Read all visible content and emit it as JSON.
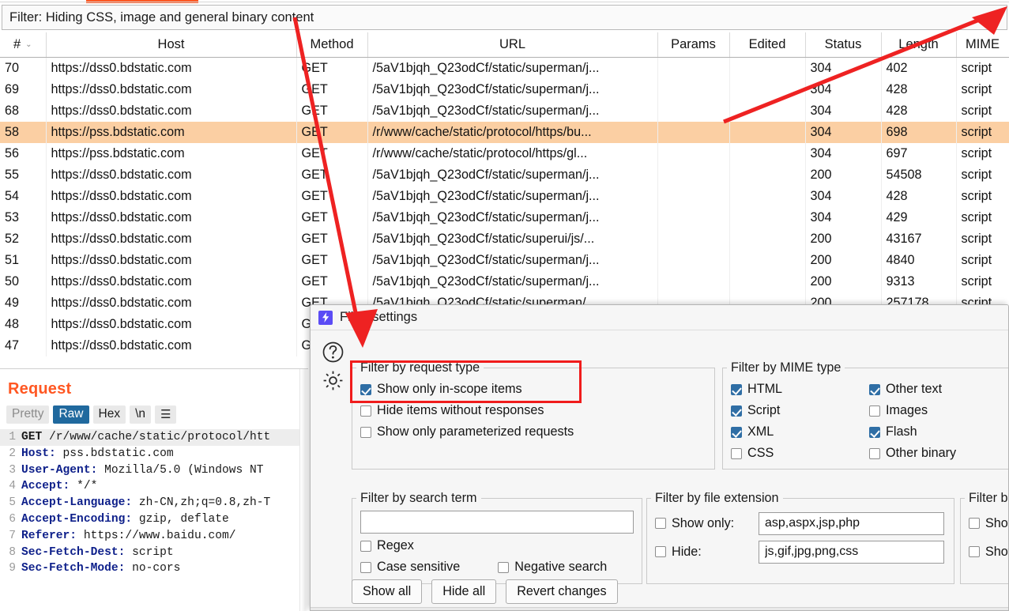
{
  "window": {
    "filter_bar_text": "Filter: Hiding CSS, image and general binary content",
    "accent_color": "#ff5722",
    "selection_color": "#fbcfa3",
    "annotation_color": "#f01c1c"
  },
  "table": {
    "columns": [
      {
        "key": "num",
        "label": "#",
        "sorted": true,
        "sort_caret": "⌄"
      },
      {
        "key": "host",
        "label": "Host"
      },
      {
        "key": "method",
        "label": "Method"
      },
      {
        "key": "url",
        "label": "URL"
      },
      {
        "key": "params",
        "label": "Params"
      },
      {
        "key": "edited",
        "label": "Edited"
      },
      {
        "key": "status",
        "label": "Status"
      },
      {
        "key": "length",
        "label": "Length"
      },
      {
        "key": "mime",
        "label": "MIME"
      }
    ],
    "rows": [
      {
        "num": "70",
        "host": "https://dss0.bdstatic.com",
        "method": "GET",
        "url": "/5aV1bjqh_Q23odCf/static/superman/j...",
        "params": "",
        "edited": "",
        "status": "304",
        "length": "402",
        "mime": "script",
        "selected": false
      },
      {
        "num": "69",
        "host": "https://dss0.bdstatic.com",
        "method": "GET",
        "url": "/5aV1bjqh_Q23odCf/static/superman/j...",
        "params": "",
        "edited": "",
        "status": "304",
        "length": "428",
        "mime": "script",
        "selected": false
      },
      {
        "num": "68",
        "host": "https://dss0.bdstatic.com",
        "method": "GET",
        "url": "/5aV1bjqh_Q23odCf/static/superman/j...",
        "params": "",
        "edited": "",
        "status": "304",
        "length": "428",
        "mime": "script",
        "selected": false
      },
      {
        "num": "58",
        "host": "https://pss.bdstatic.com",
        "method": "GET",
        "url": "/r/www/cache/static/protocol/https/bu...",
        "params": "",
        "edited": "",
        "status": "304",
        "length": "698",
        "mime": "script",
        "selected": true
      },
      {
        "num": "56",
        "host": "https://pss.bdstatic.com",
        "method": "GET",
        "url": "/r/www/cache/static/protocol/https/gl...",
        "params": "",
        "edited": "",
        "status": "304",
        "length": "697",
        "mime": "script",
        "selected": false
      },
      {
        "num": "55",
        "host": "https://dss0.bdstatic.com",
        "method": "GET",
        "url": "/5aV1bjqh_Q23odCf/static/superman/j...",
        "params": "",
        "edited": "",
        "status": "200",
        "length": "54508",
        "mime": "script",
        "selected": false
      },
      {
        "num": "54",
        "host": "https://dss0.bdstatic.com",
        "method": "GET",
        "url": "/5aV1bjqh_Q23odCf/static/superman/j...",
        "params": "",
        "edited": "",
        "status": "304",
        "length": "428",
        "mime": "script",
        "selected": false
      },
      {
        "num": "53",
        "host": "https://dss0.bdstatic.com",
        "method": "GET",
        "url": "/5aV1bjqh_Q23odCf/static/superman/j...",
        "params": "",
        "edited": "",
        "status": "304",
        "length": "429",
        "mime": "script",
        "selected": false
      },
      {
        "num": "52",
        "host": "https://dss0.bdstatic.com",
        "method": "GET",
        "url": "/5aV1bjqh_Q23odCf/static/superui/js/...",
        "params": "",
        "edited": "",
        "status": "200",
        "length": "43167",
        "mime": "script",
        "selected": false
      },
      {
        "num": "51",
        "host": "https://dss0.bdstatic.com",
        "method": "GET",
        "url": "/5aV1bjqh_Q23odCf/static/superman/j...",
        "params": "",
        "edited": "",
        "status": "200",
        "length": "4840",
        "mime": "script",
        "selected": false
      },
      {
        "num": "50",
        "host": "https://dss0.bdstatic.com",
        "method": "GET",
        "url": "/5aV1bjqh_Q23odCf/static/superman/j...",
        "params": "",
        "edited": "",
        "status": "200",
        "length": "9313",
        "mime": "script",
        "selected": false
      },
      {
        "num": "49",
        "host": "https://dss0.bdstatic.com",
        "method": "GET",
        "url": "/5aV1bjqh_Q23odCf/static/superman/...",
        "params": "",
        "edited": "",
        "status": "200",
        "length": "257178",
        "mime": "script",
        "selected": false
      },
      {
        "num": "48",
        "host": "https://dss0.bdstatic.com",
        "method": "G",
        "url": "",
        "params": "",
        "edited": "",
        "status": "",
        "length": "",
        "mime": "",
        "selected": false
      },
      {
        "num": "47",
        "host": "https://dss0.bdstatic.com",
        "method": "G",
        "url": "",
        "params": "",
        "edited": "",
        "status": "",
        "length": "",
        "mime": "",
        "selected": false
      }
    ]
  },
  "request_panel": {
    "title": "Request",
    "tabs": [
      {
        "label": "Pretty",
        "state": "inactive"
      },
      {
        "label": "Raw",
        "state": "active"
      },
      {
        "label": "Hex",
        "state": "dark"
      },
      {
        "label": "\\n",
        "state": "dark"
      }
    ],
    "menu_icon": "hamburger-icon",
    "lines": [
      {
        "n": "1",
        "key": "GET",
        "val": " /r/www/cache/static/protocol/htt",
        "bold_key": true
      },
      {
        "n": "2",
        "key": "Host:",
        "val": " pss.bdstatic.com"
      },
      {
        "n": "3",
        "key": "User-Agent:",
        "val": " Mozilla/5.0 (Windows NT"
      },
      {
        "n": "4",
        "key": "Accept:",
        "val": " */*"
      },
      {
        "n": "5",
        "key": "Accept-Language:",
        "val": " zh-CN,zh;q=0.8,zh-T"
      },
      {
        "n": "6",
        "key": "Accept-Encoding:",
        "val": " gzip, deflate"
      },
      {
        "n": "7",
        "key": "Referer:",
        "val": " https://www.baidu.com/"
      },
      {
        "n": "8",
        "key": "Sec-Fetch-Dest:",
        "val": " script"
      },
      {
        "n": "9",
        "key": "Sec-Fetch-Mode:",
        "val": " no-cors"
      }
    ]
  },
  "dialog": {
    "title": "Filter settings",
    "app_icon": "burp-logo-icon",
    "help_icon": "question-circle-icon",
    "settings_icon": "gear-icon",
    "request_type": {
      "legend": "Filter by request type",
      "highlighted": true,
      "items": [
        {
          "label": "Show only in-scope items",
          "checked": true
        },
        {
          "label": "Hide items without responses",
          "checked": false
        },
        {
          "label": "Show only parameterized requests",
          "checked": false
        }
      ]
    },
    "mime_type": {
      "legend": "Filter by MIME type",
      "left": [
        {
          "label": "HTML",
          "checked": true
        },
        {
          "label": "Script",
          "checked": true
        },
        {
          "label": "XML",
          "checked": true
        },
        {
          "label": "CSS",
          "checked": false
        }
      ],
      "right": [
        {
          "label": "Other text",
          "checked": true
        },
        {
          "label": "Images",
          "checked": false
        },
        {
          "label": "Flash",
          "checked": true
        },
        {
          "label": "Other binary",
          "checked": false
        }
      ]
    },
    "search_term": {
      "legend": "Filter by search term",
      "value": "",
      "placeholder": "",
      "options": [
        {
          "label": "Regex",
          "checked": false
        },
        {
          "label": "Case sensitive",
          "checked": false
        },
        {
          "label": "Negative search",
          "checked": false
        }
      ]
    },
    "file_extension": {
      "legend": "Filter by file extension",
      "rows": [
        {
          "label": "Show only:",
          "checked": false,
          "value": "asp,aspx,jsp,php"
        },
        {
          "label": "Hide:",
          "checked": false,
          "value": "js,gif,jpg,png,css"
        }
      ]
    },
    "annotation_group": {
      "legend": "Filter b",
      "rows": [
        {
          "label": "Show",
          "checked": false
        },
        {
          "label": "Show",
          "checked": false
        }
      ]
    },
    "buttons": [
      {
        "label": "Show all"
      },
      {
        "label": "Hide all"
      },
      {
        "label": "Revert changes"
      }
    ]
  }
}
